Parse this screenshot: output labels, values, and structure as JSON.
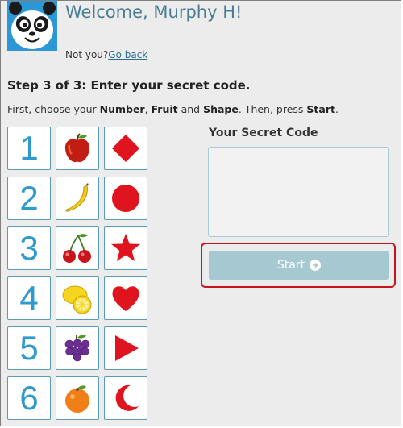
{
  "header": {
    "welcome": "Welcome, Murphy H!",
    "not_you": "Not you?",
    "go_back": "Go back"
  },
  "step": {
    "title": "Step 3 of 3: Enter your secret code.",
    "instructions_prefix": "First, choose your ",
    "number_word": "Number",
    "comma": ", ",
    "fruit_word": "Fruit",
    "and_text": " and ",
    "shape_word": "Shape",
    "then_press": ". Then, press ",
    "start_word": "Start",
    "period": "."
  },
  "numbers": [
    "1",
    "2",
    "3",
    "4",
    "5",
    "6"
  ],
  "fruits": [
    "apple-icon",
    "banana-icon",
    "cherries-icon",
    "lemon-icon",
    "grapes-icon",
    "orange-icon"
  ],
  "shapes": [
    "diamond-icon",
    "circle-icon",
    "star-icon",
    "heart-icon",
    "triangle-icon",
    "crescent-icon"
  ],
  "code": {
    "label": "Your Secret Code",
    "value": ""
  },
  "start": {
    "label": "Start"
  },
  "colors": {
    "accent": "#2e9ad0",
    "shape_red": "#e0141e",
    "button_disabled": "#a5c8d1",
    "highlight_outline": "#c9141b"
  }
}
